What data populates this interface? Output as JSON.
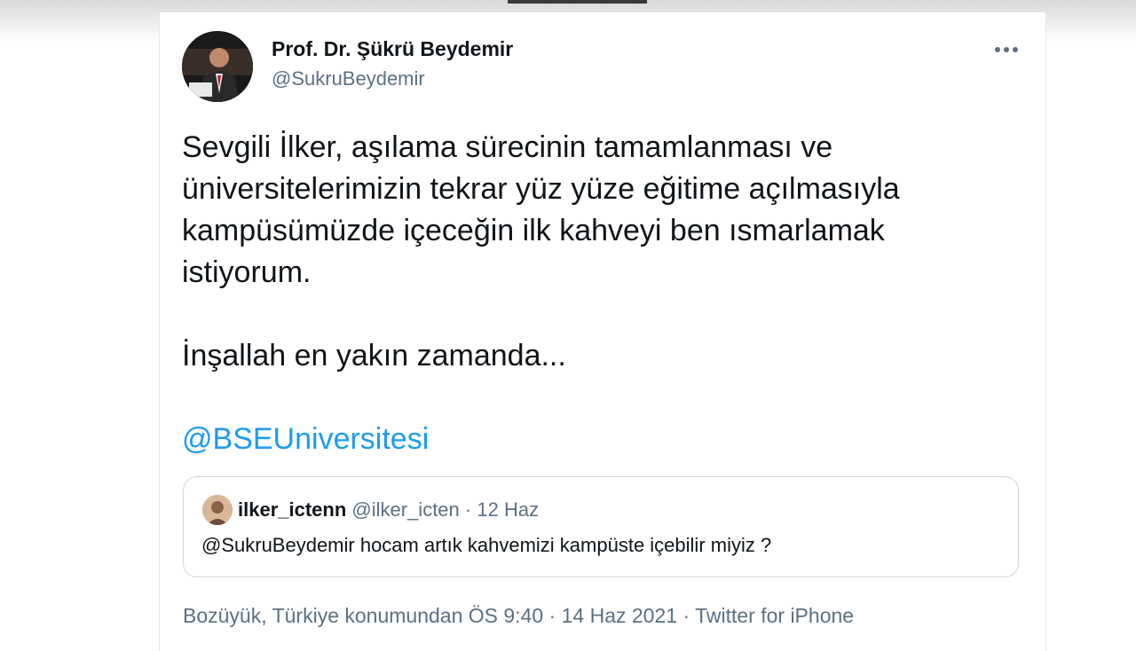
{
  "colors": {
    "text": "#0f1419",
    "secondary": "#5b7083",
    "link": "#1d9bf0",
    "border": "#cfd9de"
  },
  "tweet": {
    "author": {
      "display_name": "Prof. Dr. Şükrü Beydemir",
      "handle": "@SukruBeydemir",
      "avatar_icon": "profile-photo"
    },
    "more_icon": "more-horizontal-icon",
    "text_lines": [
      "Sevgili İlker, aşılama sürecinin tamamlanması ve",
      "üniversitelerimizin tekrar yüz yüze eğitime açılmasıyla",
      "kampüsümüzde içeceğin ilk kahveyi ben ısmarlamak",
      "istiyorum."
    ],
    "text_line2": "İnşallah en yakın zamanda...",
    "mention": "@BSEUniversitesi",
    "quote": {
      "display_name": "ilker_ictenn",
      "handle": "@ilker_icten",
      "separator": "·",
      "date": "12 Haz",
      "text": "@SukruBeydemir hocam artık kahvemizi kampüste içebilir miyiz ?"
    },
    "meta": {
      "location": "Bozüyük, Türkiye konumundan",
      "time": "ÖS 9:40",
      "separator": "·",
      "date": "14 Haz 2021",
      "source": "Twitter for iPhone"
    }
  }
}
